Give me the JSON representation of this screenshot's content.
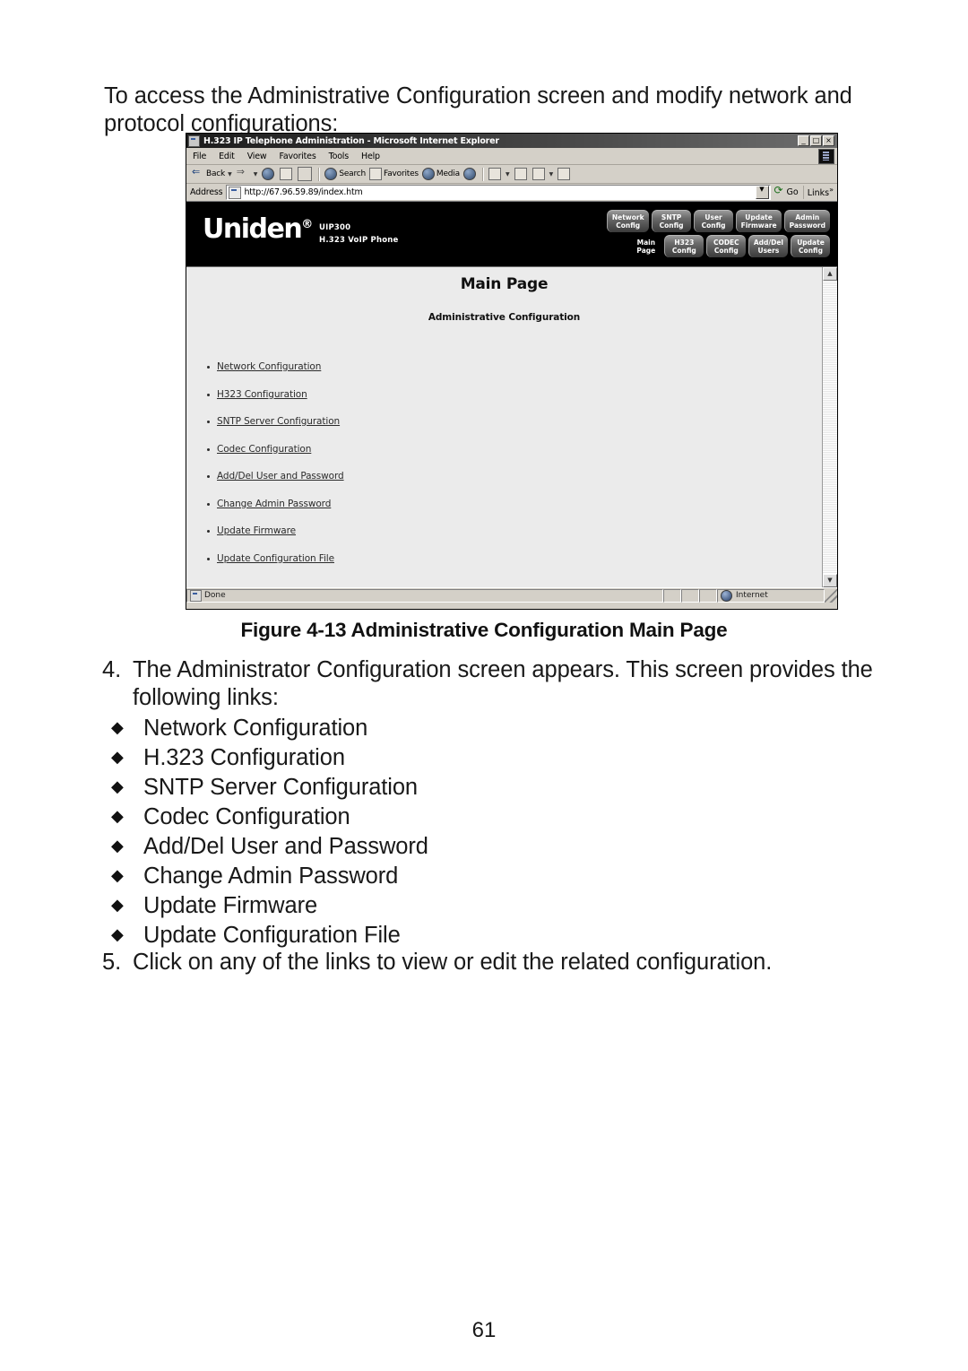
{
  "document": {
    "intro_paragraph": "To access the Administrative Configuration screen and modify network and protocol configurations:",
    "figure_caption": "Figure 4-13 Administrative Configuration Main Page",
    "step4_number": "4.",
    "step4_text": "The Administrator Configuration screen appears. This screen provides the following links:",
    "step5_number": "5.",
    "step5_text": "Click on any of the links to view or edit the related configuration.",
    "bullet_links": [
      "Network Configuration",
      "H.323 Configuration",
      "SNTP Server Configuration",
      "Codec Configuration",
      "Add/Del User and Password",
      "Change Admin Password",
      "Update Firmware",
      "Update Configuration File"
    ],
    "page_number": "61"
  },
  "browser": {
    "title": "H.323 IP Telephone Administration - Microsoft Internet Explorer",
    "window_buttons": {
      "minimize": "_",
      "maximize": "□",
      "close": "×"
    },
    "menu": [
      {
        "label": "File"
      },
      {
        "label": "Edit"
      },
      {
        "label": "View"
      },
      {
        "label": "Favorites"
      },
      {
        "label": "Tools"
      },
      {
        "label": "Help"
      }
    ],
    "toolbar": [
      {
        "label": "Back",
        "icon": "back-arrow-icon",
        "caret": true
      },
      {
        "label": "",
        "icon": "forward-arrow-icon",
        "caret": true
      },
      {
        "label": "",
        "icon": "stop-icon",
        "caret": false
      },
      {
        "label": "",
        "icon": "refresh-icon",
        "caret": false
      },
      {
        "label": "",
        "icon": "home-icon",
        "caret": false
      },
      {
        "label": "Search",
        "icon": "search-icon",
        "caret": false
      },
      {
        "label": "Favorites",
        "icon": "favorites-icon",
        "caret": false
      },
      {
        "label": "Media",
        "icon": "media-icon",
        "caret": false
      },
      {
        "label": "",
        "icon": "history-icon",
        "caret": false
      },
      {
        "label": "",
        "icon": "mail-icon",
        "caret": true
      },
      {
        "label": "",
        "icon": "print-icon",
        "caret": false
      },
      {
        "label": "",
        "icon": "edit-word-icon",
        "caret": true
      },
      {
        "label": "",
        "icon": "messenger-icon",
        "caret": false
      }
    ],
    "address": {
      "label": "Address",
      "value": "http://67.96.59.89/index.htm",
      "placeholder": "http://",
      "go_label": "Go",
      "links_label": "Links"
    },
    "status": {
      "text": "Done",
      "zone": "Internet"
    }
  },
  "webpage": {
    "brand": "Uniden",
    "brand_mark": "®",
    "model": "UIP300",
    "model_subtitle": "H.323 VoIP Phone",
    "nav_row_1": [
      "Network\nConfig",
      "SNTP\nConfig",
      "User\nConfig",
      "Update\nFirmware",
      "Admin\nPassword"
    ],
    "nav_row_2": [
      "Main\nPage",
      "H323\nConfig",
      "CODEC\nConfig",
      "Add/Del\nUsers",
      "Update\nConfig"
    ],
    "title": "Main Page",
    "subtitle": "Administrative Configuration",
    "links": [
      "Network Configuration",
      "H323 Configuration",
      "SNTP Server Configuration",
      "Codec Configuration",
      "Add/Del User and Password",
      "Change Admin Password",
      "Update Firmware",
      "Update Configuration File"
    ]
  },
  "colors": {
    "header_background": "#000000",
    "page_background": "#ebebeb",
    "chrome_background": "#d4d0c8",
    "link_text": "#2b2b2b"
  }
}
